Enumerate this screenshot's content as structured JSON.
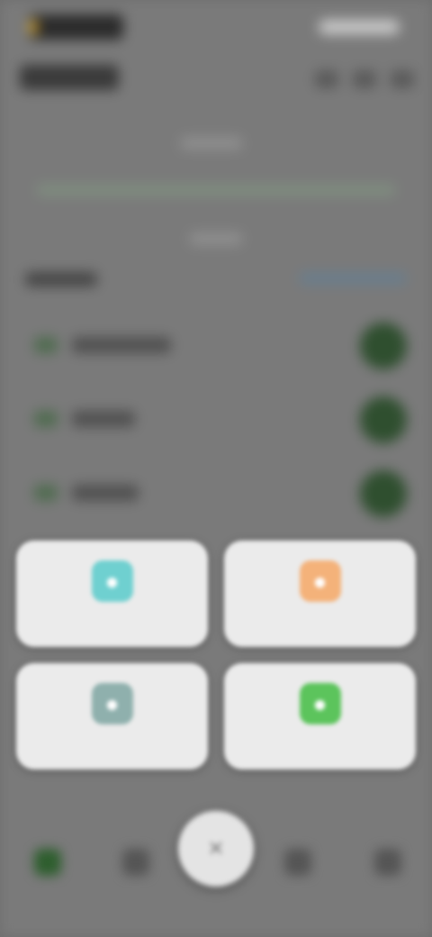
{
  "colors": {
    "accent_green": "#2f4f2f",
    "card_background": "#ebebeb",
    "icon_teal": "#6fd0d0",
    "icon_orange": "#f4b27a",
    "icon_gray_teal": "#8fb0ad",
    "icon_green": "#5cc45c"
  },
  "overlay_menu": {
    "actions": [
      {
        "label": "",
        "icon": "teal-action-icon"
      },
      {
        "label": "",
        "icon": "orange-action-icon"
      },
      {
        "label": "",
        "icon": "gray-action-icon"
      },
      {
        "label": "",
        "icon": "green-action-icon"
      }
    ]
  },
  "fab": {
    "icon": "close-icon"
  }
}
